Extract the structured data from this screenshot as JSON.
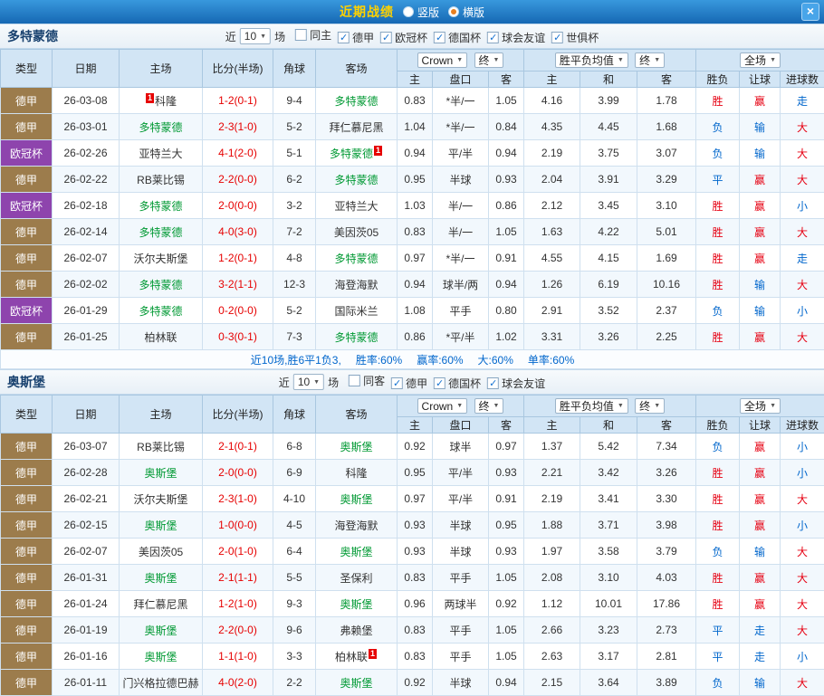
{
  "titlebar": {
    "title": "近期战绩",
    "options": [
      {
        "label": "竖版",
        "selected": false
      },
      {
        "label": "横版",
        "selected": true
      }
    ],
    "close": "×"
  },
  "colors": {
    "accent_red": "#e60012",
    "accent_blue": "#0066cc",
    "focus_green": "#009933",
    "score_red": "#e60000",
    "title_yellow": "#ffd200",
    "league": {
      "德甲": "#9C7C4C",
      "欧冠杯": "#8E44AD"
    }
  },
  "table_header": {
    "cols": [
      "类型",
      "日期",
      "主场",
      "比分(半场)",
      "角球",
      "客场"
    ],
    "sub": [
      "主",
      "盘口",
      "客",
      "主",
      "和",
      "客",
      "胜负",
      "让球",
      "进球数"
    ],
    "company_select": "Crown",
    "final_select": "终",
    "avg_select": "胜平负均值",
    "scope_select": "全场"
  },
  "sections": [
    {
      "team": "多特蒙德",
      "filter": {
        "prefix": "近",
        "count": "10",
        "suffix": "场",
        "checks": [
          {
            "label": "同主",
            "checked": false
          },
          {
            "label": "德甲",
            "checked": true
          },
          {
            "label": "欧冠杯",
            "checked": true
          },
          {
            "label": "德国杯",
            "checked": true
          },
          {
            "label": "球会友谊",
            "checked": true
          },
          {
            "label": "世俱杯",
            "checked": true
          }
        ]
      },
      "rows": [
        {
          "league": "德甲",
          "date": "26-03-08",
          "home": {
            "name": "科隆",
            "focus": false,
            "badge": "1",
            "badge_pos": "pre"
          },
          "score": "1-2(0-1)",
          "corners": "9-4",
          "away": {
            "name": "多特蒙德",
            "focus": true
          },
          "odds": [
            "0.83",
            "*半/一",
            "1.05"
          ],
          "avg": [
            "4.16",
            "3.99",
            "1.78"
          ],
          "results": [
            {
              "t": "胜",
              "c": "r"
            },
            {
              "t": "赢",
              "c": "r"
            },
            {
              "t": "走",
              "c": "b"
            }
          ]
        },
        {
          "league": "德甲",
          "date": "26-03-01",
          "home": {
            "name": "多特蒙德",
            "focus": true
          },
          "score": "2-3(1-0)",
          "corners": "5-2",
          "away": {
            "name": "拜仁慕尼黑",
            "focus": false
          },
          "odds": [
            "1.04",
            "*半/一",
            "0.84"
          ],
          "avg": [
            "4.35",
            "4.45",
            "1.68"
          ],
          "results": [
            {
              "t": "负",
              "c": "b"
            },
            {
              "t": "输",
              "c": "b"
            },
            {
              "t": "大",
              "c": "r"
            }
          ]
        },
        {
          "league": "欧冠杯",
          "date": "26-02-26",
          "home": {
            "name": "亚特兰大",
            "focus": false
          },
          "score": "4-1(2-0)",
          "corners": "5-1",
          "away": {
            "name": "多特蒙德",
            "focus": true,
            "badge": "1",
            "badge_pos": "post"
          },
          "odds": [
            "0.94",
            "平/半",
            "0.94"
          ],
          "avg": [
            "2.19",
            "3.75",
            "3.07"
          ],
          "results": [
            {
              "t": "负",
              "c": "b"
            },
            {
              "t": "输",
              "c": "b"
            },
            {
              "t": "大",
              "c": "r"
            }
          ]
        },
        {
          "league": "德甲",
          "date": "26-02-22",
          "home": {
            "name": "RB莱比锡",
            "focus": false
          },
          "score": "2-2(0-0)",
          "corners": "6-2",
          "away": {
            "name": "多特蒙德",
            "focus": true
          },
          "odds": [
            "0.95",
            "半球",
            "0.93"
          ],
          "avg": [
            "2.04",
            "3.91",
            "3.29"
          ],
          "results": [
            {
              "t": "平",
              "c": "b"
            },
            {
              "t": "赢",
              "c": "r"
            },
            {
              "t": "大",
              "c": "r"
            }
          ]
        },
        {
          "league": "欧冠杯",
          "date": "26-02-18",
          "home": {
            "name": "多特蒙德",
            "focus": true
          },
          "score": "2-0(0-0)",
          "corners": "3-2",
          "away": {
            "name": "亚特兰大",
            "focus": false
          },
          "odds": [
            "1.03",
            "半/一",
            "0.86"
          ],
          "avg": [
            "2.12",
            "3.45",
            "3.10"
          ],
          "results": [
            {
              "t": "胜",
              "c": "r"
            },
            {
              "t": "赢",
              "c": "r"
            },
            {
              "t": "小",
              "c": "b"
            }
          ]
        },
        {
          "league": "德甲",
          "date": "26-02-14",
          "home": {
            "name": "多特蒙德",
            "focus": true
          },
          "score": "4-0(3-0)",
          "corners": "7-2",
          "away": {
            "name": "美因茨05",
            "focus": false
          },
          "odds": [
            "0.83",
            "半/一",
            "1.05"
          ],
          "avg": [
            "1.63",
            "4.22",
            "5.01"
          ],
          "results": [
            {
              "t": "胜",
              "c": "r"
            },
            {
              "t": "赢",
              "c": "r"
            },
            {
              "t": "大",
              "c": "r"
            }
          ]
        },
        {
          "league": "德甲",
          "date": "26-02-07",
          "home": {
            "name": "沃尔夫斯堡",
            "focus": false
          },
          "score": "1-2(0-1)",
          "corners": "4-8",
          "away": {
            "name": "多特蒙德",
            "focus": true
          },
          "odds": [
            "0.97",
            "*半/一",
            "0.91"
          ],
          "avg": [
            "4.55",
            "4.15",
            "1.69"
          ],
          "results": [
            {
              "t": "胜",
              "c": "r"
            },
            {
              "t": "赢",
              "c": "r"
            },
            {
              "t": "走",
              "c": "b"
            }
          ]
        },
        {
          "league": "德甲",
          "date": "26-02-02",
          "home": {
            "name": "多特蒙德",
            "focus": true
          },
          "score": "3-2(1-1)",
          "corners": "12-3",
          "away": {
            "name": "海登海默",
            "focus": false
          },
          "odds": [
            "0.94",
            "球半/两",
            "0.94"
          ],
          "avg": [
            "1.26",
            "6.19",
            "10.16"
          ],
          "results": [
            {
              "t": "胜",
              "c": "r"
            },
            {
              "t": "输",
              "c": "b"
            },
            {
              "t": "大",
              "c": "r"
            }
          ]
        },
        {
          "league": "欧冠杯",
          "date": "26-01-29",
          "home": {
            "name": "多特蒙德",
            "focus": true
          },
          "score": "0-2(0-0)",
          "corners": "5-2",
          "away": {
            "name": "国际米兰",
            "focus": false
          },
          "odds": [
            "1.08",
            "平手",
            "0.80"
          ],
          "avg": [
            "2.91",
            "3.52",
            "2.37"
          ],
          "results": [
            {
              "t": "负",
              "c": "b"
            },
            {
              "t": "输",
              "c": "b"
            },
            {
              "t": "小",
              "c": "b"
            }
          ]
        },
        {
          "league": "德甲",
          "date": "26-01-25",
          "home": {
            "name": "柏林联",
            "focus": false
          },
          "score": "0-3(0-1)",
          "corners": "7-3",
          "away": {
            "name": "多特蒙德",
            "focus": true
          },
          "odds": [
            "0.86",
            "*平/半",
            "1.02"
          ],
          "avg": [
            "3.31",
            "3.26",
            "2.25"
          ],
          "results": [
            {
              "t": "胜",
              "c": "r"
            },
            {
              "t": "赢",
              "c": "r"
            },
            {
              "t": "大",
              "c": "r"
            }
          ]
        }
      ],
      "summary": {
        "lead": "近10场,胜6平1负3,",
        "stats": [
          "胜率:60%",
          "赢率:60%",
          "大:60%",
          "单率:60%"
        ]
      }
    },
    {
      "team": "奥斯堡",
      "filter": {
        "prefix": "近",
        "count": "10",
        "suffix": "场",
        "checks": [
          {
            "label": "同客",
            "checked": false
          },
          {
            "label": "德甲",
            "checked": true
          },
          {
            "label": "德国杯",
            "checked": true
          },
          {
            "label": "球会友谊",
            "checked": true
          }
        ]
      },
      "rows": [
        {
          "league": "德甲",
          "date": "26-03-07",
          "home": {
            "name": "RB莱比锡",
            "focus": false
          },
          "score": "2-1(0-1)",
          "corners": "6-8",
          "away": {
            "name": "奥斯堡",
            "focus": true
          },
          "odds": [
            "0.92",
            "球半",
            "0.97"
          ],
          "avg": [
            "1.37",
            "5.42",
            "7.34"
          ],
          "results": [
            {
              "t": "负",
              "c": "b"
            },
            {
              "t": "赢",
              "c": "r"
            },
            {
              "t": "小",
              "c": "b"
            }
          ]
        },
        {
          "league": "德甲",
          "date": "26-02-28",
          "home": {
            "name": "奥斯堡",
            "focus": true
          },
          "score": "2-0(0-0)",
          "corners": "6-9",
          "away": {
            "name": "科隆",
            "focus": false
          },
          "odds": [
            "0.95",
            "平/半",
            "0.93"
          ],
          "avg": [
            "2.21",
            "3.42",
            "3.26"
          ],
          "results": [
            {
              "t": "胜",
              "c": "r"
            },
            {
              "t": "赢",
              "c": "r"
            },
            {
              "t": "小",
              "c": "b"
            }
          ]
        },
        {
          "league": "德甲",
          "date": "26-02-21",
          "home": {
            "name": "沃尔夫斯堡",
            "focus": false
          },
          "score": "2-3(1-0)",
          "corners": "4-10",
          "away": {
            "name": "奥斯堡",
            "focus": true
          },
          "odds": [
            "0.97",
            "平/半",
            "0.91"
          ],
          "avg": [
            "2.19",
            "3.41",
            "3.30"
          ],
          "results": [
            {
              "t": "胜",
              "c": "r"
            },
            {
              "t": "赢",
              "c": "r"
            },
            {
              "t": "大",
              "c": "r"
            }
          ]
        },
        {
          "league": "德甲",
          "date": "26-02-15",
          "home": {
            "name": "奥斯堡",
            "focus": true
          },
          "score": "1-0(0-0)",
          "corners": "4-5",
          "away": {
            "name": "海登海默",
            "focus": false
          },
          "odds": [
            "0.93",
            "半球",
            "0.95"
          ],
          "avg": [
            "1.88",
            "3.71",
            "3.98"
          ],
          "results": [
            {
              "t": "胜",
              "c": "r"
            },
            {
              "t": "赢",
              "c": "r"
            },
            {
              "t": "小",
              "c": "b"
            }
          ]
        },
        {
          "league": "德甲",
          "date": "26-02-07",
          "home": {
            "name": "美因茨05",
            "focus": false
          },
          "score": "2-0(1-0)",
          "corners": "6-4",
          "away": {
            "name": "奥斯堡",
            "focus": true
          },
          "odds": [
            "0.93",
            "半球",
            "0.93"
          ],
          "avg": [
            "1.97",
            "3.58",
            "3.79"
          ],
          "results": [
            {
              "t": "负",
              "c": "b"
            },
            {
              "t": "输",
              "c": "b"
            },
            {
              "t": "大",
              "c": "r"
            }
          ]
        },
        {
          "league": "德甲",
          "date": "26-01-31",
          "home": {
            "name": "奥斯堡",
            "focus": true
          },
          "score": "2-1(1-1)",
          "corners": "5-5",
          "away": {
            "name": "圣保利",
            "focus": false
          },
          "odds": [
            "0.83",
            "平手",
            "1.05"
          ],
          "avg": [
            "2.08",
            "3.10",
            "4.03"
          ],
          "results": [
            {
              "t": "胜",
              "c": "r"
            },
            {
              "t": "赢",
              "c": "r"
            },
            {
              "t": "大",
              "c": "r"
            }
          ]
        },
        {
          "league": "德甲",
          "date": "26-01-24",
          "home": {
            "name": "拜仁慕尼黑",
            "focus": false
          },
          "score": "1-2(1-0)",
          "corners": "9-3",
          "away": {
            "name": "奥斯堡",
            "focus": true
          },
          "odds": [
            "0.96",
            "两球半",
            "0.92"
          ],
          "avg": [
            "1.12",
            "10.01",
            "17.86"
          ],
          "results": [
            {
              "t": "胜",
              "c": "r"
            },
            {
              "t": "赢",
              "c": "r"
            },
            {
              "t": "大",
              "c": "r"
            }
          ]
        },
        {
          "league": "德甲",
          "date": "26-01-19",
          "home": {
            "name": "奥斯堡",
            "focus": true
          },
          "score": "2-2(0-0)",
          "corners": "9-6",
          "away": {
            "name": "弗赖堡",
            "focus": false
          },
          "odds": [
            "0.83",
            "平手",
            "1.05"
          ],
          "avg": [
            "2.66",
            "3.23",
            "2.73"
          ],
          "results": [
            {
              "t": "平",
              "c": "b"
            },
            {
              "t": "走",
              "c": "b"
            },
            {
              "t": "大",
              "c": "r"
            }
          ]
        },
        {
          "league": "德甲",
          "date": "26-01-16",
          "home": {
            "name": "奥斯堡",
            "focus": true
          },
          "score": "1-1(1-0)",
          "corners": "3-3",
          "away": {
            "name": "柏林联",
            "focus": false,
            "badge": "1",
            "badge_pos": "post"
          },
          "odds": [
            "0.83",
            "平手",
            "1.05"
          ],
          "avg": [
            "2.63",
            "3.17",
            "2.81"
          ],
          "results": [
            {
              "t": "平",
              "c": "b"
            },
            {
              "t": "走",
              "c": "b"
            },
            {
              "t": "小",
              "c": "b"
            }
          ]
        },
        {
          "league": "德甲",
          "date": "26-01-11",
          "home": {
            "name": "门兴格拉德巴赫",
            "focus": false
          },
          "score": "4-0(2-0)",
          "corners": "2-2",
          "away": {
            "name": "奥斯堡",
            "focus": true
          },
          "odds": [
            "0.92",
            "半球",
            "0.94"
          ],
          "avg": [
            "2.15",
            "3.64",
            "3.89"
          ],
          "results": [
            {
              "t": "负",
              "c": "b"
            },
            {
              "t": "输",
              "c": "b"
            },
            {
              "t": "大",
              "c": "r"
            }
          ]
        }
      ],
      "summary": null
    }
  ]
}
